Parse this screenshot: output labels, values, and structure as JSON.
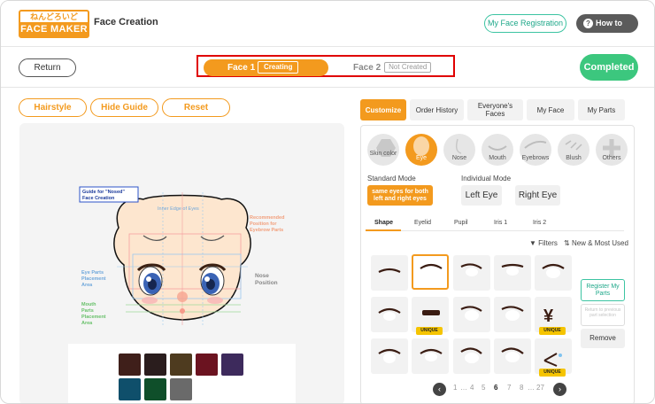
{
  "header": {
    "logo_top": "ねんどろいど",
    "logo_bottom": "FACE MAKER",
    "title": "Face Creation",
    "registration_label": "My Face Registration",
    "how_to_use_label": "How to Use"
  },
  "toolbar": {
    "return_label": "Return",
    "tab1_label": "Face 1",
    "tab1_status": "Creating",
    "tab2_label": "Face 2",
    "tab2_status": "Not Created",
    "completed_label": "Completed"
  },
  "left": {
    "hairstyle_label": "Hairstyle",
    "hide_guide_label": "Hide Guide",
    "reset_label": "Reset",
    "guide": {
      "title_line1": "Guide for \"Nosed\"",
      "title_line2": "Face Creation",
      "inner_edge": "Inner Edge of Eyes",
      "eyebrow_line1": "Recommended",
      "eyebrow_line2": "Position for",
      "eyebrow_line3": "Eyebrow Parts",
      "eye_area_line1": "Eye Parts",
      "eye_area_line2": "Placement",
      "eye_area_line3": "Area",
      "nose_line1": "Nose",
      "nose_line2": "Position",
      "mouth_line1": "Mouth",
      "mouth_line2": "Parts",
      "mouth_line3": "Placement",
      "mouth_line4": "Area"
    },
    "swatches": [
      "#3f1f1a",
      "#2a1d1d",
      "#4e3b1f",
      "#6b1320",
      "#3d2a5c",
      "#0f4f6b",
      "#0f4f2a",
      "#6a6a6a"
    ]
  },
  "right": {
    "tabs": [
      "Customize",
      "Order History",
      "Everyone's Faces",
      "My Face",
      "My Parts"
    ],
    "categories": [
      "Skin color",
      "Eye",
      "Nose",
      "Mouth",
      "Eyebrows",
      "Blush",
      "Others"
    ],
    "standard_mode_label": "Standard Mode",
    "standard_mode_button": "same eyes for both left and right eyes",
    "individual_mode_label": "Individual Mode",
    "left_eye_label": "Left Eye",
    "right_eye_label": "Right Eye",
    "subtabs": [
      "Shape",
      "Eyelid",
      "Pupil",
      "Iris 1",
      "Iris 2"
    ],
    "filters_label": "Filters",
    "sort_label": "New & Most Used",
    "unique_label": "UNIQUE",
    "register_label": "Register My Parts",
    "return_prev_label": "Return to previous part selection",
    "remove_label": "Remove",
    "pager": {
      "p1": "1",
      "dots1": "…",
      "p4": "4",
      "p5": "5",
      "p6": "6",
      "p7": "7",
      "p8": "8",
      "dots2": "…",
      "p27": "27"
    },
    "accent_color": "#f39a1e",
    "selected_category": "Eye",
    "selected_subtab": "Shape"
  }
}
